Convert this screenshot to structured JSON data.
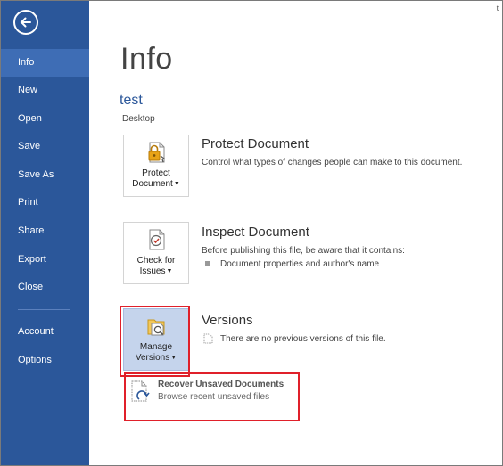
{
  "sidebar": {
    "items": [
      {
        "id": "info",
        "label": "Info",
        "active": true
      },
      {
        "id": "new",
        "label": "New"
      },
      {
        "id": "open",
        "label": "Open"
      },
      {
        "id": "save",
        "label": "Save"
      },
      {
        "id": "save-as",
        "label": "Save As"
      },
      {
        "id": "print",
        "label": "Print"
      },
      {
        "id": "share",
        "label": "Share"
      },
      {
        "id": "export",
        "label": "Export"
      },
      {
        "id": "close",
        "label": "Close"
      },
      {
        "id": "account",
        "label": "Account"
      },
      {
        "id": "options",
        "label": "Options"
      }
    ]
  },
  "corner_char": "t",
  "main": {
    "title": "Info",
    "document": {
      "name": "test",
      "location": "Desktop"
    },
    "protect": {
      "button_line1": "Protect",
      "button_line2": "Document",
      "title": "Protect Document",
      "desc": "Control what types of changes people can make to this document."
    },
    "inspect": {
      "button_line1": "Check for",
      "button_line2": "Issues",
      "title": "Inspect Document",
      "desc": "Before publishing this file, be aware that it contains:",
      "bullet": "Document properties and author's name"
    },
    "versions": {
      "button_line1": "Manage",
      "button_line2": "Versions",
      "title": "Versions",
      "desc": "There are no previous versions of this file."
    },
    "recover": {
      "title": "Recover Unsaved Documents",
      "desc": "Browse recent unsaved files"
    }
  },
  "colors": {
    "sidebar": "#2b579a",
    "sidebar_active": "#3e6db5",
    "accent": "#2b579a",
    "highlight": "#e0202a"
  }
}
